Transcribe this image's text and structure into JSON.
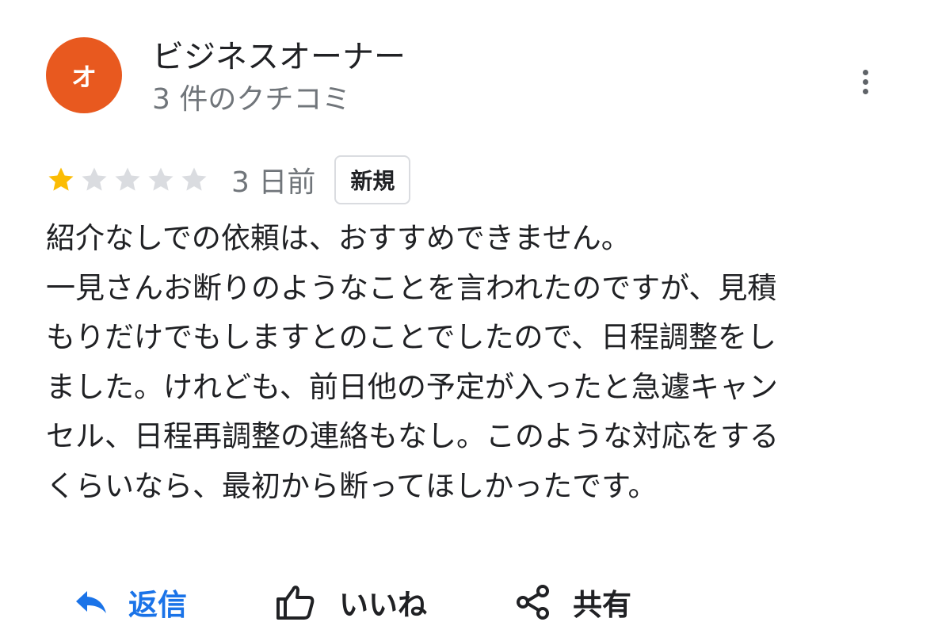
{
  "author": {
    "avatar_initial": "オ",
    "avatar_color": "#e8591f",
    "name": "ビジネスオーナー",
    "review_count": "3 件のクチコミ"
  },
  "more_menu_icon": "more-vert-icon",
  "review": {
    "rating": 1,
    "max_rating": 5,
    "star_filled_color": "#fbbc04",
    "star_empty_color": "#dadce0",
    "date": "3 日前",
    "badge": "新規",
    "text_lines": [
      "紹介なしでの依頼は、おすすめできません。",
      "一見さんお断りのようなことを言われたのですが、見積",
      "もりだけでもしますとのことでしたので、日程調整をし",
      "ました。けれども、前日他の予定が入ったと急遽キャン",
      "セル、日程再調整の連絡もなし。このような対応をする",
      "くらいなら、最初から断ってほしかったです。"
    ]
  },
  "actions": {
    "reply": {
      "icon": "reply-icon",
      "label": "返信",
      "color": "#1a73e8"
    },
    "like": {
      "icon": "thumb-up-icon",
      "label": "いいね"
    },
    "share": {
      "icon": "share-icon",
      "label": "共有"
    }
  }
}
